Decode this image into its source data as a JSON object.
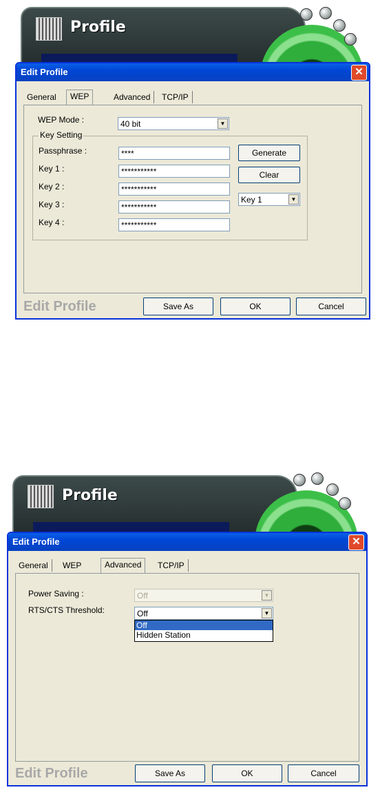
{
  "shot1": {
    "app_title": "Profile",
    "dialog_title": "Edit Profile",
    "close_glyph": "✕",
    "tabs": [
      {
        "label": "General"
      },
      {
        "label": "WEP"
      },
      {
        "label": "Advanced"
      },
      {
        "label": "TCP/IP"
      }
    ],
    "active_tab": "WEP",
    "wep_mode_label": "WEP Mode :",
    "wep_mode_value": "40 bit",
    "group_label": "Key Setting",
    "passphrase_label": "Passphrase :",
    "passphrase_value": "****",
    "keys": [
      {
        "label": "Key 1 :",
        "value": "***********"
      },
      {
        "label": "Key 2 :",
        "value": "***********"
      },
      {
        "label": "Key 3 :",
        "value": "***********"
      },
      {
        "label": "Key 4 :",
        "value": "***********"
      }
    ],
    "generate_label": "Generate",
    "clear_label": "Clear",
    "key_select_value": "Key 1",
    "footer_title": "Edit Profile",
    "save_as_label": "Save As",
    "ok_label": "OK",
    "cancel_label": "Cancel"
  },
  "shot2": {
    "app_title": "Profile",
    "dialog_title": "Edit Profile",
    "close_glyph": "✕",
    "tabs": [
      {
        "label": "General"
      },
      {
        "label": "WEP"
      },
      {
        "label": "Advanced"
      },
      {
        "label": "TCP/IP"
      }
    ],
    "active_tab": "Advanced",
    "power_saving_label": "Power Saving :",
    "power_saving_value": "Off",
    "rts_label": "RTS/CTS Threshold:",
    "rts_value": "Off",
    "rts_options": [
      "Off",
      "Hidden Station"
    ],
    "footer_title": "Edit Profile",
    "save_as_label": "Save As",
    "ok_label": "OK",
    "cancel_label": "Cancel"
  },
  "icons": {
    "dropdown": "▼",
    "logo": "app-logo-icon",
    "orb": "green-orb-icon",
    "bubbles": "window-control-bubble-icon"
  },
  "colors": {
    "titlebar": "#0046d5",
    "close": "#e04a2a",
    "dialog_bg": "#ece9d8",
    "selection": "#316ac5",
    "orb_green": "#2fae3b"
  }
}
